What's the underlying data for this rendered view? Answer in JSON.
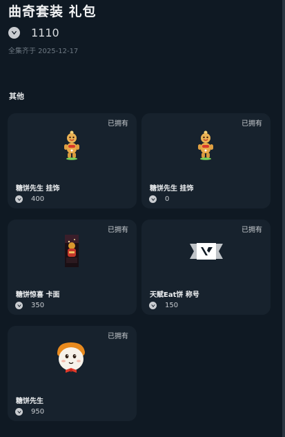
{
  "bundle": {
    "title": "曲奇套装 礼包",
    "price": "1110",
    "date_note": "全集齐于 2025-12-17"
  },
  "section": {
    "label": "其他"
  },
  "items": [
    {
      "name": "糖饼先生 挂饰",
      "price": "400",
      "status": "已拥有"
    },
    {
      "name": "糖饼先生 挂饰",
      "price": "0",
      "status": "已拥有"
    },
    {
      "name": "糖饼惊喜 卡面",
      "price": "350",
      "status": "已拥有"
    },
    {
      "name": "天赋Eat饼 称号",
      "price": "150",
      "status": "已拥有"
    },
    {
      "name": "糖饼先生",
      "price": "950",
      "status": "已拥有"
    }
  ],
  "icons": {
    "currency": "valorant-points-icon"
  },
  "colors": {
    "background": "#0f1923",
    "card": "#17222d",
    "text": "#eef0f2"
  }
}
